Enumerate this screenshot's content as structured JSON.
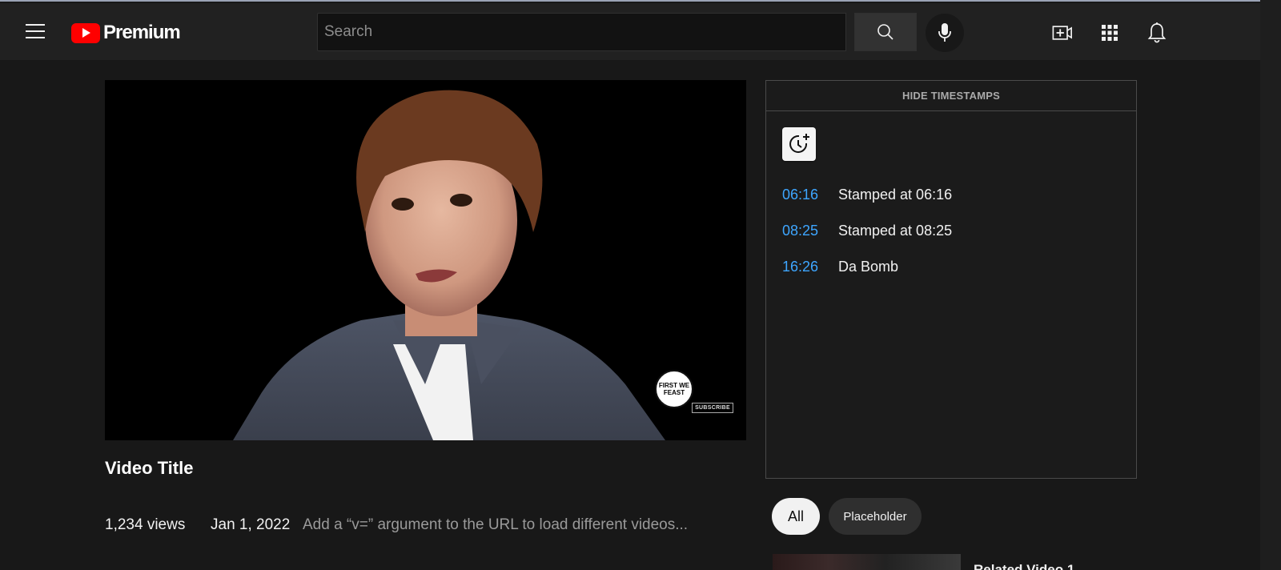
{
  "masthead": {
    "logo_text": "Premium",
    "search_placeholder": "Search",
    "icons": [
      "menu-icon",
      "search-icon",
      "mic-icon",
      "create-video-icon",
      "apps-grid-icon",
      "bell-icon"
    ]
  },
  "player": {
    "channel_logo_text": "FIRST WE FEAST",
    "subscribe_badge": "SUBSCRIBE"
  },
  "video": {
    "title": "Video Title",
    "views": "1,234 views",
    "date": "Jan 1, 2022",
    "description": "Add a “v=” argument to the URL to load different videos..."
  },
  "timestamps": {
    "toggle_label": "HIDE TIMESTAMPS",
    "add_icon": "clock-plus-icon",
    "items": [
      {
        "time": "06:16",
        "label": "Stamped at 06:16"
      },
      {
        "time": "08:25",
        "label": "Stamped at 08:25"
      },
      {
        "time": "16:26",
        "label": "Da Bomb"
      }
    ]
  },
  "chips": [
    {
      "label": "All",
      "selected": true
    },
    {
      "label": "Placeholder",
      "selected": false
    }
  ],
  "related": [
    {
      "title": "Related Video 1"
    }
  ],
  "colors": {
    "brand_red": "#ff0000",
    "timestamp_link": "#3ea6ff",
    "background": "#181818",
    "masthead": "#212121"
  }
}
